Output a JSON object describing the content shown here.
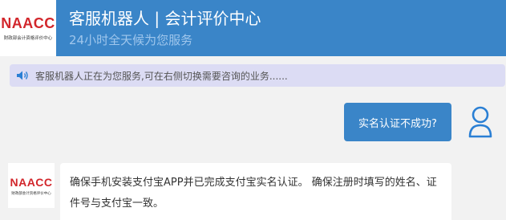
{
  "header": {
    "logo": "NAACC",
    "logo_subtitle": "财政部会计资格评价中心",
    "title": "客服机器人 | 会计评价中心",
    "subtitle": "24小时全天候为您服务"
  },
  "notice": {
    "icon": "speaker-icon",
    "text": "客服机器人正在为您服务,可在右侧切换需要咨询的业务......"
  },
  "conversation": {
    "user_message": "实名认证不成功?",
    "user_avatar_icon": "user-icon",
    "bot_logo": "NAACC",
    "bot_logo_subtitle": "财政部会计资格评价中心",
    "bot_message": "确保手机安装支付宝APP并已完成支付宝实名认证。 确保注册时填写的姓名、证件号与支付宝一致。"
  },
  "colors": {
    "header_bg": "#3a85c8",
    "logo_red": "#d2262b",
    "notice_bg": "#dcdcf4",
    "user_bubble_bg": "#3a85c8",
    "page_bg": "#f2f2f2"
  }
}
